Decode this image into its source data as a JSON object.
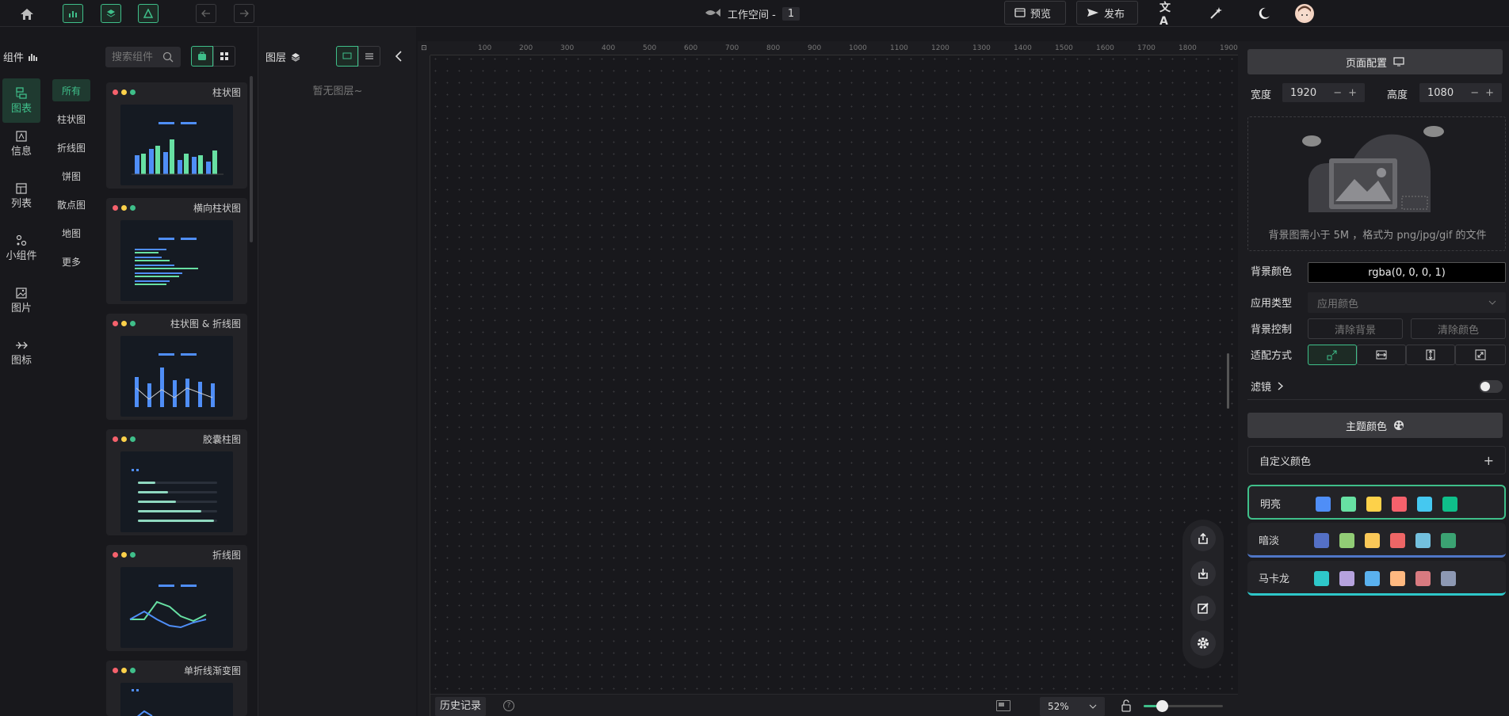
{
  "topbar": {
    "workspace_label": "工作空间 -",
    "workspace_number": "1",
    "preview_label": "预览",
    "publish_label": "发布"
  },
  "left_categories": [
    {
      "label": "图表",
      "icon": "chart-icon",
      "active": true
    },
    {
      "label": "信息",
      "icon": "text-icon",
      "active": false
    },
    {
      "label": "列表",
      "icon": "table-icon",
      "active": false
    },
    {
      "label": "小组件",
      "icon": "widget-icon",
      "active": false
    },
    {
      "label": "图片",
      "icon": "image-icon",
      "active": false
    },
    {
      "label": "图标",
      "icon": "icon-icon",
      "active": false
    }
  ],
  "components": {
    "title": "组件",
    "search_placeholder": "搜索组件",
    "subcategories": [
      "所有",
      "柱状图",
      "折线图",
      "饼图",
      "散点图",
      "地图",
      "更多"
    ],
    "cards": [
      "柱状图",
      "横向柱状图",
      "柱状图 & 折线图",
      "胶囊柱图",
      "折线图",
      "单折线渐变图"
    ]
  },
  "layers": {
    "title": "图层",
    "empty_text": "暂无图层~"
  },
  "canvas": {
    "ruler_ticks": [
      "100",
      "200",
      "300",
      "400",
      "500",
      "600",
      "700",
      "800",
      "900",
      "1000",
      "1100",
      "1200",
      "1300",
      "1400",
      "1500",
      "1600",
      "1700",
      "1800",
      "1900"
    ],
    "history_label": "历史记录",
    "zoom": "52%"
  },
  "page_config": {
    "title": "页面配置",
    "width_label": "宽度",
    "width_value": "1920",
    "height_label": "高度",
    "height_value": "1080",
    "upload_hint": "背景图需小于 5M ，格式为 png/jpg/gif 的文件",
    "bg_color_label": "背景颜色",
    "bg_color_value": "rgba(0, 0, 0, 1)",
    "app_type_label": "应用类型",
    "app_type_value": "应用颜色",
    "bg_control_label": "背景控制",
    "clear_bg": "清除背景",
    "clear_color": "清除颜色",
    "fit_label": "适配方式",
    "filter_label": "滤镜"
  },
  "theme": {
    "title": "主题颜色",
    "custom_label": "自定义颜色",
    "themes": [
      {
        "name": "明亮",
        "colors": [
          "#4f8ef7",
          "#67e0a3",
          "#fdd14a",
          "#f5616c",
          "#45c8f0",
          "#0fbf8a"
        ]
      },
      {
        "name": "暗淡",
        "colors": [
          "#5470c6",
          "#91cc75",
          "#fac858",
          "#ee6666",
          "#73c0de",
          "#3ba272"
        ]
      },
      {
        "name": "马卡龙",
        "colors": [
          "#2ec7c9",
          "#b6a2de",
          "#5ab1ef",
          "#ffb980",
          "#d87a80",
          "#8d98b3"
        ]
      }
    ]
  },
  "accent": "#3fbf8a"
}
